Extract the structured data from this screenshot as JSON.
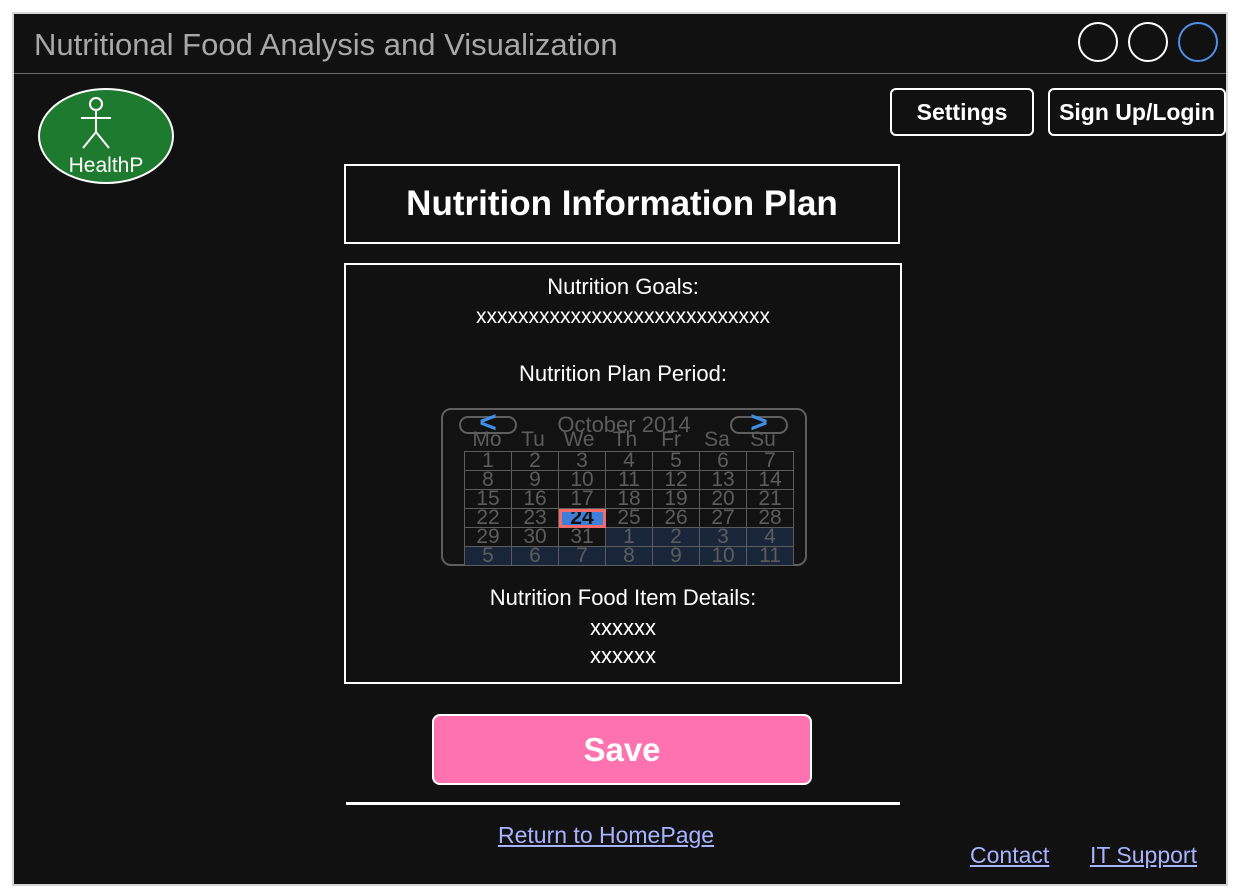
{
  "window": {
    "title": "Nutritional Food Analysis and Visualization"
  },
  "logo": {
    "text": "HealthP"
  },
  "header_buttons": {
    "settings": "Settings",
    "signup_login": "Sign Up/Login"
  },
  "page": {
    "title": "Nutrition Information Plan"
  },
  "card": {
    "goals_label": "Nutrition Goals:",
    "goals_value": "xxxxxxxxxxxxxxxxxxxxxxxxxxxx",
    "period_label": "Nutrition Plan Period:",
    "details_label": "Nutrition Food Item Details:",
    "details_line1": "xxxxxx",
    "details_line2": "xxxxxx"
  },
  "calendar": {
    "month_label": "October 2014",
    "prev_symbol": "<",
    "next_symbol": ">",
    "weekdays": [
      "Mo",
      "Tu",
      "We",
      "Th",
      "Fr",
      "Sa",
      "Su"
    ],
    "selected_day": 24,
    "weeks": [
      [
        "1",
        "2",
        "3",
        "4",
        "5",
        "6",
        "7"
      ],
      [
        "8",
        "9",
        "10",
        "11",
        "12",
        "13",
        "14"
      ],
      [
        "15",
        "16",
        "17",
        "18",
        "19",
        "20",
        "21"
      ],
      [
        "22",
        "23",
        "24",
        "25",
        "26",
        "27",
        "28"
      ],
      [
        "29",
        "30",
        "31",
        "1",
        "2",
        "3",
        "4"
      ],
      [
        "5",
        "6",
        "7",
        "8",
        "9",
        "10",
        "11"
      ]
    ],
    "accent_color": "#3d7fd9",
    "selected_outline_color": "#f36b6b"
  },
  "actions": {
    "save_label": "Save",
    "save_color": "#ff72b0"
  },
  "footer": {
    "return_home": "Return to HomePage",
    "contact": "Contact",
    "it_support": "IT Support"
  }
}
